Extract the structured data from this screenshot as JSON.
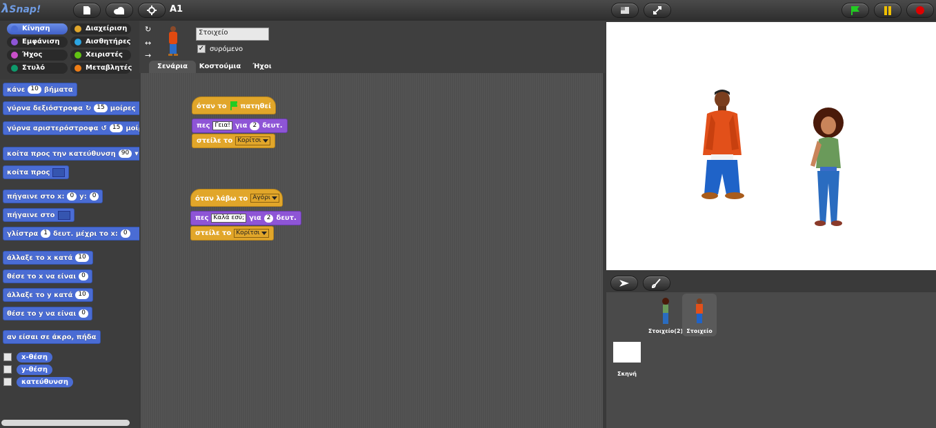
{
  "app": {
    "logo": "Snap!",
    "logo_lambda": "λ",
    "project_name": "A1"
  },
  "colors": {
    "motion": "#4a6cd4",
    "looks": "#8e55d6",
    "control": "#e1a62a",
    "sound": "#c94fc9",
    "pen": "#0e9a6c",
    "variables": "#ee7d16",
    "sensing": "#2ca5e2",
    "operators": "#62c213",
    "green_flag": "#22cc22",
    "pause": "#f0c000",
    "stop": "#dd0000"
  },
  "toolbar": {
    "new_icon": "file-icon",
    "cloud_icon": "cloud-icon",
    "settings_icon": "gear-icon",
    "stage_size_icon": "stage-normal-icon",
    "fullscreen_icon": "fullscreen-icon"
  },
  "categories": [
    {
      "label": "Κίνηση",
      "color": "#4a6cd4"
    },
    {
      "label": "Διαχείριση",
      "color": "#e1a62a"
    },
    {
      "label": "Εμφάνιση",
      "color": "#8e55d6"
    },
    {
      "label": "Αισθητήρες",
      "color": "#2ca5e2"
    },
    {
      "label": "Ήχος",
      "color": "#c94fc9"
    },
    {
      "label": "Χειριστές",
      "color": "#62c213"
    },
    {
      "label": "Στυλό",
      "color": "#0e9a6c"
    },
    {
      "label": "Μεταβλητές",
      "color": "#ee7d16"
    }
  ],
  "palette": {
    "move": {
      "pre": "κάνε",
      "val": "10",
      "post": "βήματα"
    },
    "turn_cw": {
      "pre": "γύρνα δεξιόστροφα",
      "val": "15",
      "post": "μοίρες"
    },
    "turn_ccw": {
      "pre": "γύρνα αριστερόστροφα",
      "val": "15",
      "post": "μοίρες"
    },
    "point_dir": {
      "pre": "κοίτα προς την κατεύθυνση",
      "val": "90"
    },
    "point_towards": {
      "pre": "κοίτα προς"
    },
    "goto_xy": {
      "pre": "πήγαινε στο x:",
      "x": "0",
      "mid": "y:",
      "y": "0"
    },
    "goto": {
      "pre": "πήγαινε στο"
    },
    "glide": {
      "pre": "γλίστρα",
      "val": "1",
      "post": "δευτ. μέχρι το x:",
      "x": "0"
    },
    "change_x": {
      "pre": "άλλαξε το x κατά",
      "val": "10"
    },
    "set_x": {
      "pre": "θέσε το x να είναι",
      "val": "0"
    },
    "change_y": {
      "pre": "άλλαξε το y κατά",
      "val": "10"
    },
    "set_y": {
      "pre": "θέσε το y να είναι",
      "val": "0"
    },
    "bounce": "αν είσαι σε άκρο, πήδα",
    "reporters": [
      "x-θέση",
      "y-θέση",
      "κατεύθυνση"
    ]
  },
  "sprite": {
    "name": "Στοιχείο",
    "draggable_label": "συρόμενο",
    "draggable_checked": "✓"
  },
  "tabs": [
    "Σενάρια",
    "Κοστούμια",
    "Ήχοι"
  ],
  "scripts": [
    {
      "hat": {
        "pre": "όταν το",
        "post": "πατηθεί"
      },
      "say": {
        "pre": "πες",
        "text": "Γεια!",
        "mid": "για",
        "secs": "2",
        "post": "δευτ."
      },
      "broadcast": {
        "pre": "στείλε το",
        "msg": "Κορίτσι"
      }
    },
    {
      "hat": {
        "pre": "όταν λάβω το",
        "msg": "Αγόρι"
      },
      "say": {
        "pre": "πες",
        "text": "Καλά εσύ;",
        "mid": "για",
        "secs": "2",
        "post": "δευτ."
      },
      "broadcast": {
        "pre": "στείλε το",
        "msg": "Κορίτσι"
      }
    }
  ],
  "corral": {
    "sprites": [
      "Στοιχείο(2)",
      "Στοιχείο"
    ],
    "stage": "Σκηνή"
  }
}
